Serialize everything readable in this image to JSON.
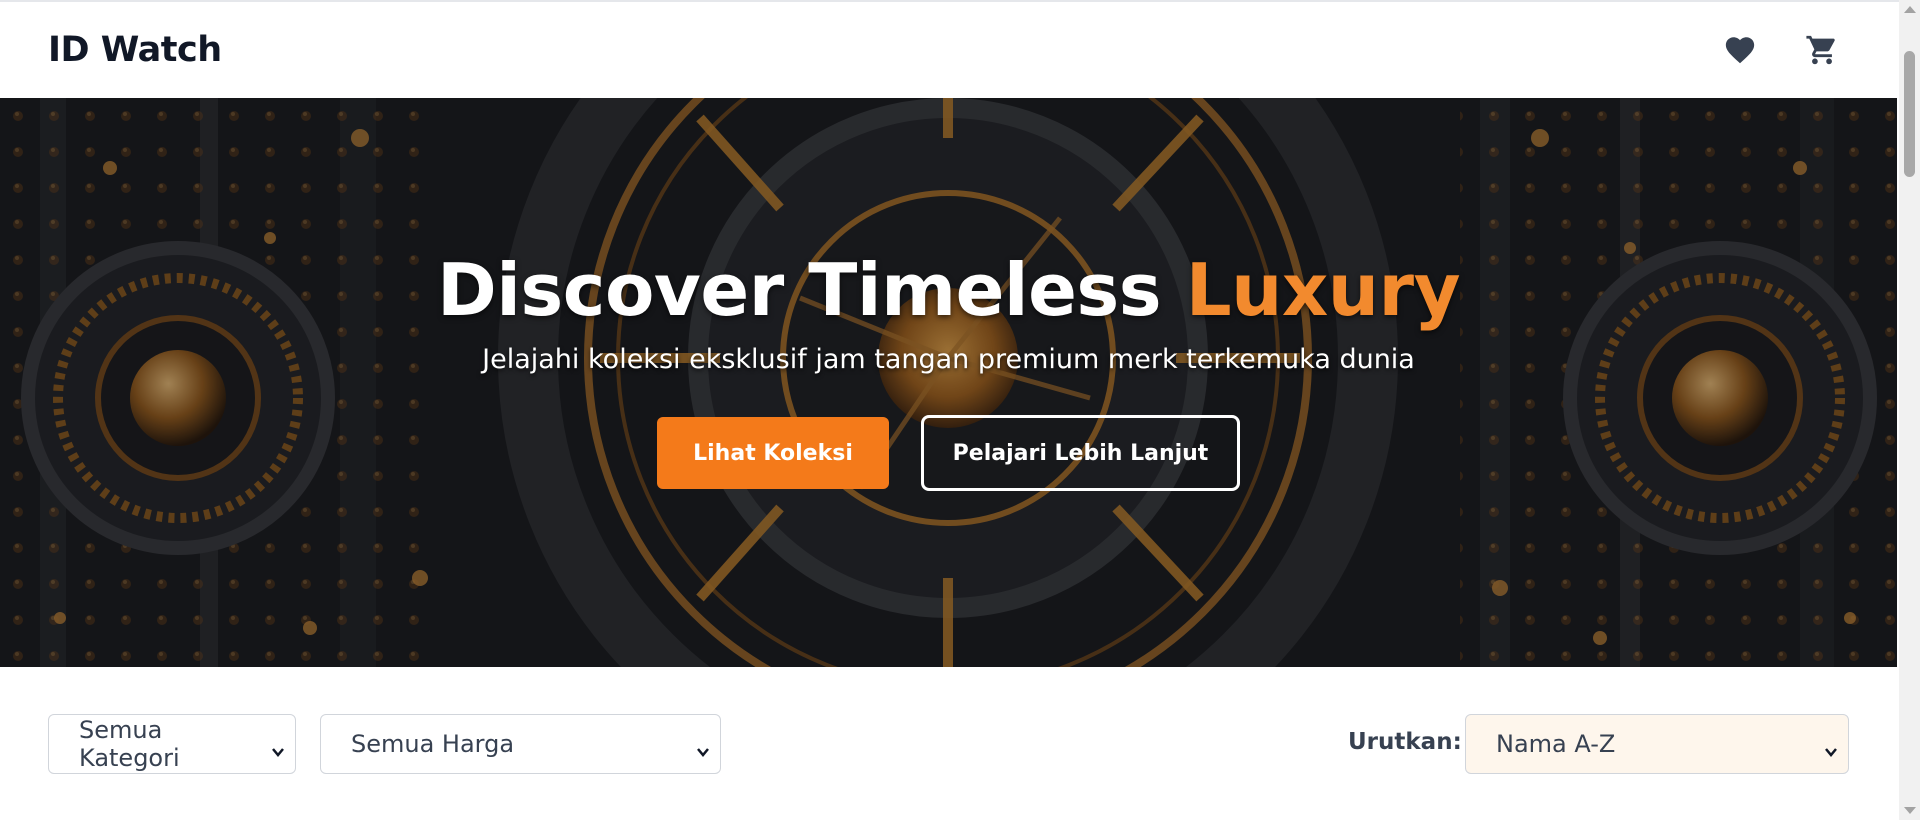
{
  "header": {
    "brand": "ID Watch",
    "wishlist_icon": "heart-icon",
    "cart_icon": "cart-icon"
  },
  "hero": {
    "title_main": "Discover Timeless",
    "title_accent": "Luxury",
    "subtitle": "Jelajahi koleksi eksklusif jam tangan premium merk terkemuka dunia",
    "primary_button": "Lihat Koleksi",
    "secondary_button": "Pelajari Lebih Lanjut"
  },
  "filters": {
    "category_selected": "Semua Kategori",
    "price_selected": "Semua Harga",
    "sort_label": "Urutkan:",
    "sort_selected": "Nama A-Z"
  },
  "colors": {
    "accent": "#f28a2e",
    "primary_button": "#f47a1a",
    "sort_select_bg": "#fef6ec",
    "brand_text": "#111827"
  }
}
